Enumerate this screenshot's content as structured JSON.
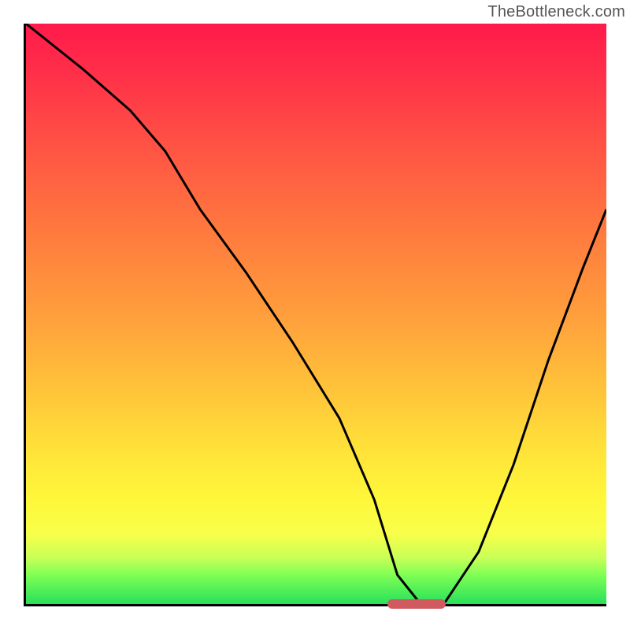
{
  "attribution": "TheBottleneck.com",
  "colors": {
    "gradient_top": "#ff1a4b",
    "gradient_bottom": "#28e05a",
    "curve": "#000000",
    "marker": "#d15a61",
    "axis": "#000000"
  },
  "chart_data": {
    "type": "line",
    "title": "",
    "xlabel": "",
    "ylabel": "",
    "xlim": [
      0,
      100
    ],
    "ylim": [
      0,
      100
    ],
    "grid": false,
    "marker": {
      "x_start": 62,
      "x_end": 72,
      "y": 0,
      "color": "#d15a61"
    },
    "series": [
      {
        "name": "curve",
        "x": [
          0,
          10,
          18,
          24,
          30,
          38,
          46,
          54,
          60,
          64,
          68,
          72,
          78,
          84,
          90,
          96,
          100
        ],
        "y": [
          100,
          92,
          85,
          78,
          68,
          57,
          45,
          32,
          18,
          5,
          0,
          0,
          9,
          24,
          42,
          58,
          68
        ]
      }
    ]
  }
}
